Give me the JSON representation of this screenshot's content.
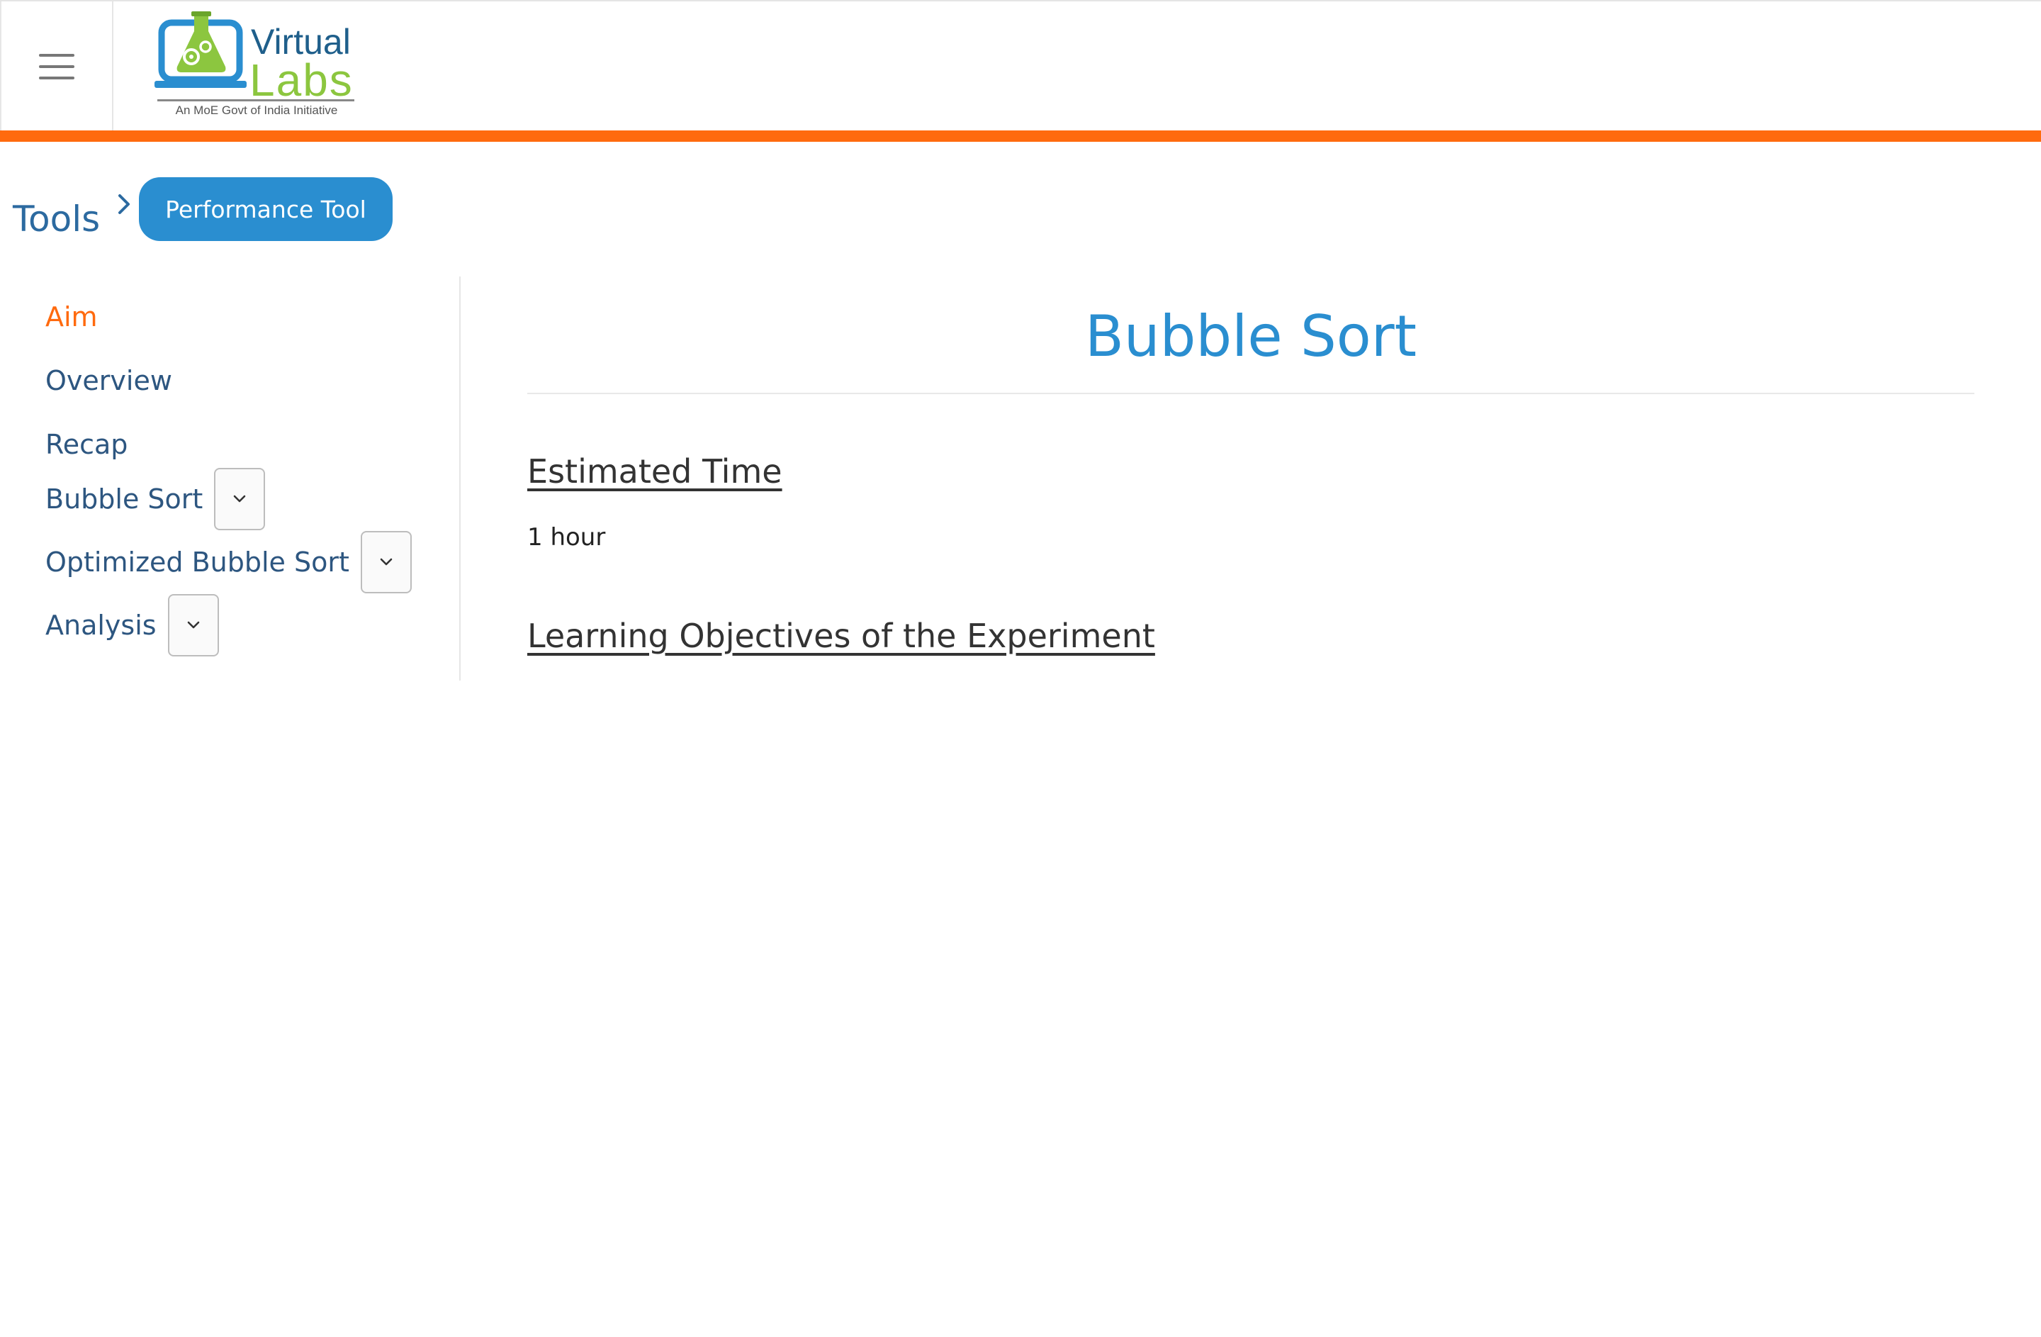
{
  "header": {
    "menu_icon": "hamburger-menu-icon",
    "logo": {
      "word1": "Virtual",
      "word2": "Labs",
      "tagline": "An MoE Govt of India Initiative",
      "icon": "flask-laptop-logo-icon"
    },
    "accent_bar_color": "#ff6a0e"
  },
  "breadcrumb": {
    "root": "Tools",
    "separator_icon": "chevron-right-icon",
    "current_button": "Performance Tool"
  },
  "sidebar": {
    "items": [
      {
        "label": "Aim",
        "active": true
      },
      {
        "label": "Overview",
        "active": false
      },
      {
        "label": "Recap",
        "active": false
      },
      {
        "label": "Bubble Sort",
        "active": false,
        "has_dropdown": true
      },
      {
        "label": "Optimized Bubble Sort",
        "active": false,
        "has_dropdown": true
      },
      {
        "label": "Analysis",
        "active": false,
        "has_dropdown": true
      }
    ]
  },
  "main": {
    "title": "Bubble Sort",
    "sections": [
      {
        "heading": "Estimated Time",
        "body": "1 hour"
      },
      {
        "heading": "Learning Objectives of the Experiment"
      }
    ]
  },
  "colors": {
    "accent_orange": "#ff6a0e",
    "link_blue": "#2d5680",
    "title_blue": "#2a8ed0"
  }
}
